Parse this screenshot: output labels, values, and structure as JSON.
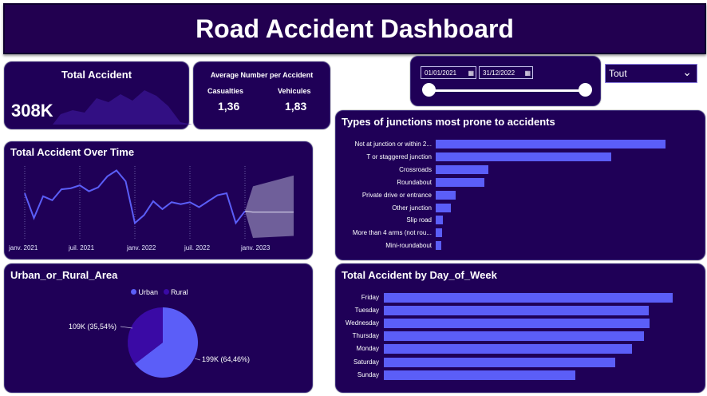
{
  "header": {
    "title": "Road Accident Dashboard"
  },
  "kpi_total": {
    "label": "Total Accident",
    "value": "308K"
  },
  "kpi_avg": {
    "label": "Average Number per Accident",
    "casualties_label": "Casualties",
    "casualties_value": "1,36",
    "vehicles_label": "Vehicules",
    "vehicles_value": "1,83"
  },
  "filters": {
    "start_date": "01/01/2021",
    "end_date": "31/12/2022",
    "dropdown_value": "Tout"
  },
  "colors": {
    "background": "#1f0057",
    "bar": "#5b5ef8",
    "urban": "#5b5ef8",
    "rural": "#3a0aa5"
  },
  "over_time": {
    "title": "Total Accident Over Time",
    "x_ticks": [
      "janv. 2021",
      "juil. 2021",
      "janv. 2022",
      "juil. 2022",
      "janv. 2023"
    ]
  },
  "urban_rural": {
    "title": "Urban_or_Rural_Area",
    "legend": [
      {
        "name": "Urban"
      },
      {
        "name": "Rural"
      }
    ],
    "labels": {
      "rural": "109K (35,54%)",
      "urban": "199K (64,46%)"
    }
  },
  "chart_data": [
    {
      "type": "line",
      "title": "Total Accident Over Time",
      "x": [
        "2021-01",
        "2021-02",
        "2021-03",
        "2021-04",
        "2021-05",
        "2021-06",
        "2021-07",
        "2021-08",
        "2021-09",
        "2021-10",
        "2021-11",
        "2021-12",
        "2022-01",
        "2022-02",
        "2022-03",
        "2022-04",
        "2022-05",
        "2022-06",
        "2022-07",
        "2022-08",
        "2022-09",
        "2022-10",
        "2022-11",
        "2022-12",
        "2023-01"
      ],
      "series": [
        {
          "values": [
            13500,
            11000,
            13200,
            12800,
            13900,
            14000,
            14300,
            13700,
            14100,
            15200,
            15800,
            14700,
            10500,
            11300,
            12700,
            11900,
            12600,
            12400,
            12600,
            12100,
            12700,
            13300,
            13500,
            10500,
            11700
          ]
        }
      ],
      "forecast": {
        "upper": [
          14200,
          15300
        ],
        "lower": [
          9000,
          9200
        ]
      }
    },
    {
      "type": "bar",
      "title": "Types of junctions most prone to accidents",
      "categories": [
        "Not at junction or within 2...",
        "T or staggered junction",
        "Crossroads",
        "Roundabout",
        "Private drive or entrance",
        "Other junction",
        "Slip road",
        "More than 4 arms (not rou...",
        "Mini-roundabout"
      ],
      "values": [
        123000,
        94000,
        28000,
        26000,
        10500,
        8000,
        4000,
        3500,
        3000
      ]
    },
    {
      "type": "bar",
      "title": "Total Accident by Day_of_Week",
      "categories": [
        "Friday",
        "Tuesday",
        "Wednesday",
        "Thursday",
        "Monday",
        "Saturday",
        "Sunday"
      ],
      "values": [
        50500,
        46300,
        46400,
        45500,
        43400,
        40500,
        33500
      ]
    },
    {
      "type": "pie",
      "title": "Urban_or_Rural_Area",
      "categories": [
        "Urban",
        "Rural"
      ],
      "values": [
        199000,
        109000
      ],
      "percents": [
        64.46,
        35.54
      ]
    }
  ]
}
